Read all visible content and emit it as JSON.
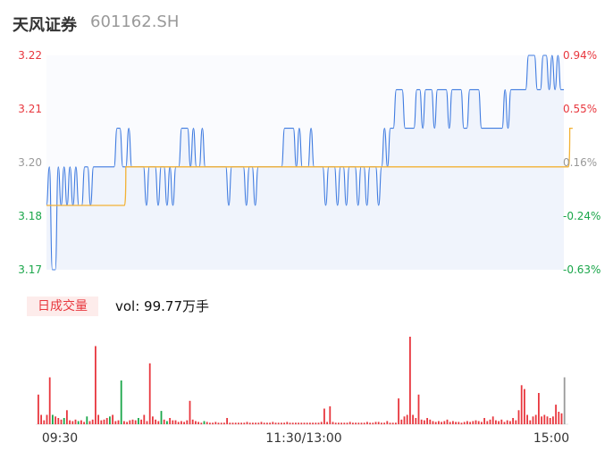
{
  "header": {
    "name": "天风证券",
    "code": "601162.SH"
  },
  "volume": {
    "badge": "日成交量",
    "label": "vol: 99.77万手"
  },
  "colors": {
    "up": "#e8373e",
    "down": "#1aa64a",
    "flat": "#999999",
    "price_line": "#3f7be0",
    "avg_line": "#f2b134"
  },
  "chart_data": {
    "type": "line",
    "x_ticks": [
      "09:30",
      "11:30/13:00",
      "15:00"
    ],
    "y_left_labels": [
      "3.22",
      "3.21",
      "3.20",
      "3.18",
      "3.17"
    ],
    "y_right_labels": [
      "0.94%",
      "0.55%",
      "0.16%",
      "-0.24%",
      "-0.63%"
    ],
    "ylim": [
      3.17,
      3.22
    ],
    "pre_close": 3.195,
    "series": [
      {
        "values": [
          3.185,
          3.194,
          3.17,
          3.17,
          3.194,
          3.185,
          3.194,
          3.185,
          3.194,
          3.185,
          3.194,
          3.185,
          3.185,
          3.194,
          3.194,
          3.185,
          3.194,
          3.194,
          3.194,
          3.194,
          3.194,
          3.194,
          3.194,
          3.194,
          3.203,
          3.203,
          3.194,
          3.194,
          3.203,
          3.194,
          3.194,
          3.194,
          3.194,
          3.194,
          3.185,
          3.194,
          3.194,
          3.194,
          3.185,
          3.194,
          3.194,
          3.185,
          3.194,
          3.185,
          3.194,
          3.194,
          3.203,
          3.203,
          3.203,
          3.194,
          3.203,
          3.194,
          3.194,
          3.203,
          3.194,
          3.194,
          3.194,
          3.194,
          3.194,
          3.194,
          3.194,
          3.194,
          3.185,
          3.194,
          3.194,
          3.194,
          3.194,
          3.194,
          3.185,
          3.194,
          3.194,
          3.185,
          3.194,
          3.194,
          3.194,
          3.194,
          3.194,
          3.194,
          3.194,
          3.194,
          3.194,
          3.203,
          3.203,
          3.203,
          3.203,
          3.194,
          3.203,
          3.194,
          3.194,
          3.194,
          3.203,
          3.194,
          3.194,
          3.194,
          3.194,
          3.185,
          3.194,
          3.194,
          3.194,
          3.185,
          3.194,
          3.194,
          3.185,
          3.194,
          3.194,
          3.194,
          3.185,
          3.194,
          3.194,
          3.185,
          3.194,
          3.194,
          3.194,
          3.185,
          3.194,
          3.203,
          3.194,
          3.203,
          3.203,
          3.212,
          3.212,
          3.212,
          3.203,
          3.203,
          3.203,
          3.203,
          3.212,
          3.212,
          3.203,
          3.212,
          3.212,
          3.212,
          3.203,
          3.212,
          3.212,
          3.212,
          3.212,
          3.203,
          3.212,
          3.212,
          3.212,
          3.212,
          3.203,
          3.203,
          3.212,
          3.212,
          3.212,
          3.212,
          3.203,
          3.203,
          3.203,
          3.203,
          3.203,
          3.203,
          3.203,
          3.203,
          3.212,
          3.203,
          3.212,
          3.212,
          3.212,
          3.212,
          3.212,
          3.212,
          3.22,
          3.22,
          3.22,
          3.212,
          3.212,
          3.22,
          3.22,
          3.212,
          3.22,
          3.212,
          3.22,
          3.212,
          3.212
        ],
        "color": "#3f7be0"
      },
      {
        "values": [
          3.185,
          3.185,
          3.185,
          3.185,
          3.185,
          3.185,
          3.185,
          3.185,
          3.185,
          3.185,
          3.185,
          3.185,
          3.185,
          3.185,
          3.185,
          3.185,
          3.185,
          3.185,
          3.185,
          3.185,
          3.185,
          3.185,
          3.185,
          3.185,
          3.185,
          3.185,
          3.185,
          3.194,
          3.194,
          3.194,
          3.194,
          3.194,
          3.194,
          3.194,
          3.194,
          3.194,
          3.194,
          3.194,
          3.194,
          3.194,
          3.194,
          3.194,
          3.194,
          3.194,
          3.194,
          3.194,
          3.194,
          3.194,
          3.194,
          3.194,
          3.194,
          3.194,
          3.194,
          3.194,
          3.194,
          3.194,
          3.194,
          3.194,
          3.194,
          3.194,
          3.194,
          3.194,
          3.194,
          3.194,
          3.194,
          3.194,
          3.194,
          3.194,
          3.194,
          3.194,
          3.194,
          3.194,
          3.194,
          3.194,
          3.194,
          3.194,
          3.194,
          3.194,
          3.194,
          3.194,
          3.194,
          3.194,
          3.194,
          3.194,
          3.194,
          3.194,
          3.194,
          3.194,
          3.194,
          3.194,
          3.194,
          3.194,
          3.194,
          3.194,
          3.194,
          3.194,
          3.194,
          3.194,
          3.194,
          3.194,
          3.194,
          3.194,
          3.194,
          3.194,
          3.194,
          3.194,
          3.194,
          3.194,
          3.194,
          3.194,
          3.194,
          3.194,
          3.194,
          3.194,
          3.194,
          3.194,
          3.194,
          3.194,
          3.194,
          3.194,
          3.194,
          3.194,
          3.194,
          3.194,
          3.194,
          3.194,
          3.194,
          3.194,
          3.194,
          3.194,
          3.194,
          3.194,
          3.194,
          3.194,
          3.194,
          3.194,
          3.194,
          3.194,
          3.194,
          3.194,
          3.194,
          3.194,
          3.194,
          3.194,
          3.194,
          3.194,
          3.194,
          3.194,
          3.194,
          3.194,
          3.194,
          3.194,
          3.194,
          3.194,
          3.194,
          3.194,
          3.194,
          3.194,
          3.194,
          3.194,
          3.194,
          3.194,
          3.194,
          3.194,
          3.194,
          3.194,
          3.194,
          3.194,
          3.194,
          3.194,
          3.194,
          3.194,
          3.194,
          3.194,
          3.194,
          3.194,
          3.194,
          3.194,
          3.203,
          3.203
        ],
        "color": "#f2b134"
      }
    ],
    "volume_bars": [
      {
        "v": 0.38,
        "c": "up"
      },
      {
        "v": 0.12,
        "c": "up"
      },
      {
        "v": 0.05,
        "c": "up"
      },
      {
        "v": 0.12,
        "c": "up"
      },
      {
        "v": 0.6,
        "c": "up"
      },
      {
        "v": 0.12,
        "c": "down"
      },
      {
        "v": 0.1,
        "c": "up"
      },
      {
        "v": 0.08,
        "c": "up"
      },
      {
        "v": 0.06,
        "c": "up"
      },
      {
        "v": 0.08,
        "c": "down"
      },
      {
        "v": 0.18,
        "c": "up"
      },
      {
        "v": 0.05,
        "c": "up"
      },
      {
        "v": 0.04,
        "c": "up"
      },
      {
        "v": 0.06,
        "c": "up"
      },
      {
        "v": 0.04,
        "c": "down"
      },
      {
        "v": 0.05,
        "c": "up"
      },
      {
        "v": 0.03,
        "c": "up"
      },
      {
        "v": 0.1,
        "c": "down"
      },
      {
        "v": 0.04,
        "c": "up"
      },
      {
        "v": 0.06,
        "c": "up"
      },
      {
        "v": 1.0,
        "c": "up"
      },
      {
        "v": 0.12,
        "c": "up"
      },
      {
        "v": 0.05,
        "c": "up"
      },
      {
        "v": 0.06,
        "c": "up"
      },
      {
        "v": 0.08,
        "c": "up"
      },
      {
        "v": 0.1,
        "c": "down"
      },
      {
        "v": 0.12,
        "c": "up"
      },
      {
        "v": 0.04,
        "c": "up"
      },
      {
        "v": 0.05,
        "c": "up"
      },
      {
        "v": 0.56,
        "c": "down"
      },
      {
        "v": 0.04,
        "c": "up"
      },
      {
        "v": 0.03,
        "c": "up"
      },
      {
        "v": 0.05,
        "c": "up"
      },
      {
        "v": 0.06,
        "c": "up"
      },
      {
        "v": 0.05,
        "c": "up"
      },
      {
        "v": 0.08,
        "c": "down"
      },
      {
        "v": 0.06,
        "c": "up"
      },
      {
        "v": 0.12,
        "c": "up"
      },
      {
        "v": 0.04,
        "c": "up"
      },
      {
        "v": 0.78,
        "c": "up"
      },
      {
        "v": 0.1,
        "c": "up"
      },
      {
        "v": 0.06,
        "c": "up"
      },
      {
        "v": 0.04,
        "c": "up"
      },
      {
        "v": 0.17,
        "c": "down"
      },
      {
        "v": 0.06,
        "c": "up"
      },
      {
        "v": 0.04,
        "c": "down"
      },
      {
        "v": 0.08,
        "c": "up"
      },
      {
        "v": 0.05,
        "c": "up"
      },
      {
        "v": 0.05,
        "c": "up"
      },
      {
        "v": 0.03,
        "c": "up"
      },
      {
        "v": 0.04,
        "c": "up"
      },
      {
        "v": 0.03,
        "c": "up"
      },
      {
        "v": 0.05,
        "c": "up"
      },
      {
        "v": 0.3,
        "c": "up"
      },
      {
        "v": 0.06,
        "c": "up"
      },
      {
        "v": 0.04,
        "c": "up"
      },
      {
        "v": 0.03,
        "c": "up"
      },
      {
        "v": 0.02,
        "c": "up"
      },
      {
        "v": 0.04,
        "c": "down"
      },
      {
        "v": 0.03,
        "c": "up"
      },
      {
        "v": 0.02,
        "c": "up"
      },
      {
        "v": 0.02,
        "c": "up"
      },
      {
        "v": 0.03,
        "c": "up"
      },
      {
        "v": 0.02,
        "c": "up"
      },
      {
        "v": 0.02,
        "c": "up"
      },
      {
        "v": 0.02,
        "c": "up"
      },
      {
        "v": 0.08,
        "c": "up"
      },
      {
        "v": 0.02,
        "c": "up"
      },
      {
        "v": 0.02,
        "c": "up"
      },
      {
        "v": 0.02,
        "c": "up"
      },
      {
        "v": 0.02,
        "c": "up"
      },
      {
        "v": 0.02,
        "c": "up"
      },
      {
        "v": 0.02,
        "c": "up"
      },
      {
        "v": 0.03,
        "c": "up"
      },
      {
        "v": 0.02,
        "c": "up"
      },
      {
        "v": 0.02,
        "c": "up"
      },
      {
        "v": 0.02,
        "c": "up"
      },
      {
        "v": 0.02,
        "c": "up"
      },
      {
        "v": 0.03,
        "c": "up"
      },
      {
        "v": 0.02,
        "c": "up"
      },
      {
        "v": 0.02,
        "c": "up"
      },
      {
        "v": 0.02,
        "c": "up"
      },
      {
        "v": 0.03,
        "c": "up"
      },
      {
        "v": 0.02,
        "c": "up"
      },
      {
        "v": 0.02,
        "c": "up"
      },
      {
        "v": 0.02,
        "c": "up"
      },
      {
        "v": 0.02,
        "c": "up"
      },
      {
        "v": 0.03,
        "c": "up"
      },
      {
        "v": 0.02,
        "c": "up"
      },
      {
        "v": 0.02,
        "c": "up"
      },
      {
        "v": 0.02,
        "c": "up"
      },
      {
        "v": 0.02,
        "c": "up"
      },
      {
        "v": 0.02,
        "c": "up"
      },
      {
        "v": 0.02,
        "c": "up"
      },
      {
        "v": 0.02,
        "c": "up"
      },
      {
        "v": 0.02,
        "c": "up"
      },
      {
        "v": 0.02,
        "c": "up"
      },
      {
        "v": 0.02,
        "c": "up"
      },
      {
        "v": 0.02,
        "c": "up"
      },
      {
        "v": 0.03,
        "c": "up"
      },
      {
        "v": 0.2,
        "c": "up"
      },
      {
        "v": 0.03,
        "c": "up"
      },
      {
        "v": 0.23,
        "c": "up"
      },
      {
        "v": 0.03,
        "c": "up"
      },
      {
        "v": 0.02,
        "c": "up"
      },
      {
        "v": 0.02,
        "c": "up"
      },
      {
        "v": 0.02,
        "c": "up"
      },
      {
        "v": 0.02,
        "c": "up"
      },
      {
        "v": 0.02,
        "c": "up"
      },
      {
        "v": 0.03,
        "c": "up"
      },
      {
        "v": 0.02,
        "c": "up"
      },
      {
        "v": 0.02,
        "c": "up"
      },
      {
        "v": 0.02,
        "c": "up"
      },
      {
        "v": 0.02,
        "c": "up"
      },
      {
        "v": 0.02,
        "c": "up"
      },
      {
        "v": 0.03,
        "c": "up"
      },
      {
        "v": 0.02,
        "c": "up"
      },
      {
        "v": 0.02,
        "c": "up"
      },
      {
        "v": 0.03,
        "c": "up"
      },
      {
        "v": 0.03,
        "c": "up"
      },
      {
        "v": 0.02,
        "c": "up"
      },
      {
        "v": 0.02,
        "c": "up"
      },
      {
        "v": 0.04,
        "c": "up"
      },
      {
        "v": 0.02,
        "c": "up"
      },
      {
        "v": 0.02,
        "c": "up"
      },
      {
        "v": 0.02,
        "c": "up"
      },
      {
        "v": 0.33,
        "c": "up"
      },
      {
        "v": 0.06,
        "c": "up"
      },
      {
        "v": 0.1,
        "c": "up"
      },
      {
        "v": 0.12,
        "c": "up"
      },
      {
        "v": 1.12,
        "c": "up"
      },
      {
        "v": 0.12,
        "c": "up"
      },
      {
        "v": 0.08,
        "c": "up"
      },
      {
        "v": 0.38,
        "c": "up"
      },
      {
        "v": 0.06,
        "c": "up"
      },
      {
        "v": 0.05,
        "c": "up"
      },
      {
        "v": 0.08,
        "c": "up"
      },
      {
        "v": 0.06,
        "c": "up"
      },
      {
        "v": 0.04,
        "c": "up"
      },
      {
        "v": 0.03,
        "c": "up"
      },
      {
        "v": 0.04,
        "c": "up"
      },
      {
        "v": 0.03,
        "c": "up"
      },
      {
        "v": 0.04,
        "c": "up"
      },
      {
        "v": 0.06,
        "c": "up"
      },
      {
        "v": 0.03,
        "c": "up"
      },
      {
        "v": 0.04,
        "c": "up"
      },
      {
        "v": 0.03,
        "c": "up"
      },
      {
        "v": 0.03,
        "c": "up"
      },
      {
        "v": 0.02,
        "c": "up"
      },
      {
        "v": 0.03,
        "c": "up"
      },
      {
        "v": 0.04,
        "c": "up"
      },
      {
        "v": 0.03,
        "c": "up"
      },
      {
        "v": 0.04,
        "c": "up"
      },
      {
        "v": 0.05,
        "c": "up"
      },
      {
        "v": 0.04,
        "c": "up"
      },
      {
        "v": 0.03,
        "c": "up"
      },
      {
        "v": 0.08,
        "c": "up"
      },
      {
        "v": 0.04,
        "c": "up"
      },
      {
        "v": 0.06,
        "c": "up"
      },
      {
        "v": 0.1,
        "c": "up"
      },
      {
        "v": 0.05,
        "c": "up"
      },
      {
        "v": 0.04,
        "c": "up"
      },
      {
        "v": 0.06,
        "c": "up"
      },
      {
        "v": 0.03,
        "c": "up"
      },
      {
        "v": 0.05,
        "c": "up"
      },
      {
        "v": 0.04,
        "c": "up"
      },
      {
        "v": 0.08,
        "c": "up"
      },
      {
        "v": 0.05,
        "c": "up"
      },
      {
        "v": 0.18,
        "c": "up"
      },
      {
        "v": 0.5,
        "c": "up"
      },
      {
        "v": 0.45,
        "c": "up"
      },
      {
        "v": 0.12,
        "c": "up"
      },
      {
        "v": 0.05,
        "c": "up"
      },
      {
        "v": 0.1,
        "c": "up"
      },
      {
        "v": 0.12,
        "c": "up"
      },
      {
        "v": 0.4,
        "c": "up"
      },
      {
        "v": 0.1,
        "c": "up"
      },
      {
        "v": 0.12,
        "c": "up"
      },
      {
        "v": 0.1,
        "c": "up"
      },
      {
        "v": 0.08,
        "c": "up"
      },
      {
        "v": 0.1,
        "c": "up"
      },
      {
        "v": 0.25,
        "c": "up"
      },
      {
        "v": 0.16,
        "c": "up"
      },
      {
        "v": 0.14,
        "c": "up"
      },
      {
        "v": 0.6,
        "c": "flat"
      }
    ]
  }
}
